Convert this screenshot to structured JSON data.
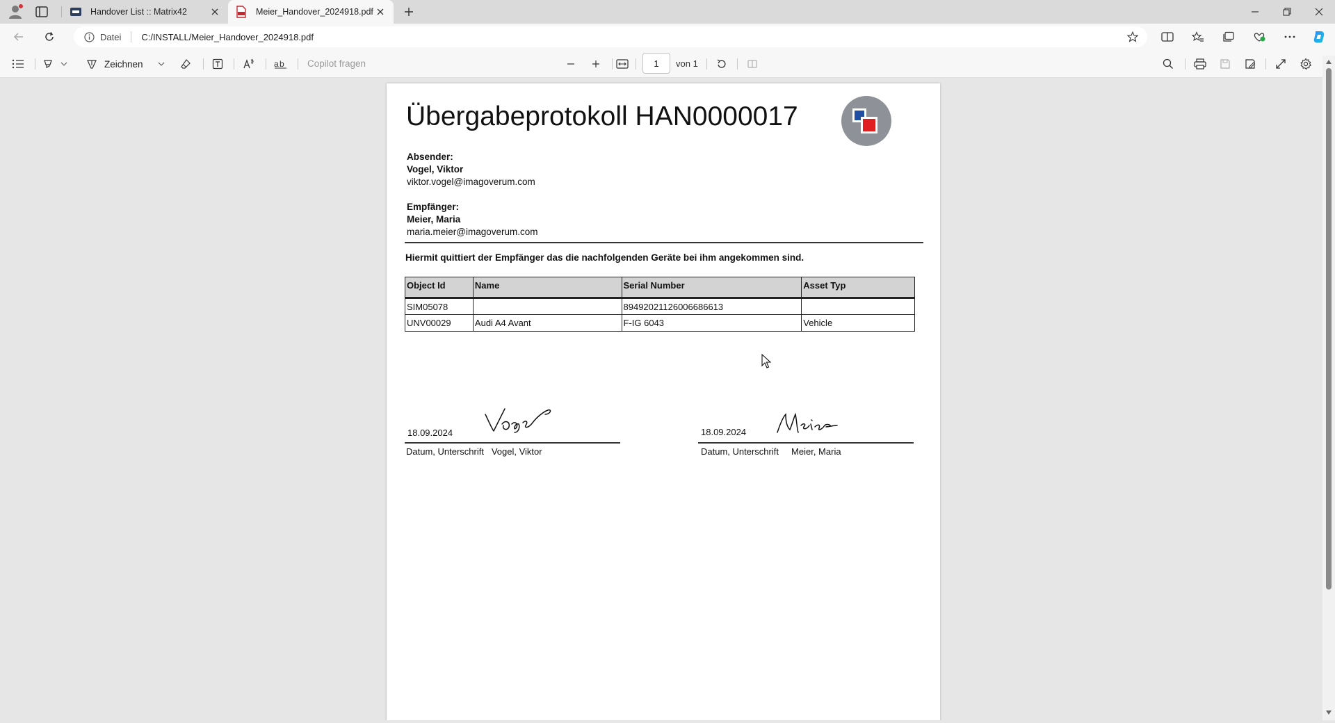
{
  "browser": {
    "tabs": [
      {
        "label": "Handover List :: Matrix42",
        "active": false,
        "icon": "matrix42-favicon"
      },
      {
        "label": "Meier_Handover_2024918.pdf",
        "active": true,
        "icon": "pdf-icon"
      }
    ],
    "address": {
      "scheme_label": "Datei",
      "url": "C:/INSTALL/Meier_Handover_2024918.pdf"
    }
  },
  "pdf_toolbar": {
    "draw_label": "Zeichnen",
    "copilot_placeholder": "Copilot fragen",
    "page_current": "1",
    "page_total_label": "von 1"
  },
  "document": {
    "title": "Übergabeprotokoll HAN0000017",
    "sender": {
      "label": "Absender:",
      "name": "Vogel, Viktor",
      "email": "viktor.vogel@imagoverum.com"
    },
    "recipient": {
      "label": "Empfänger:",
      "name": "Meier, Maria",
      "email": "maria.meier@imagoverum.com"
    },
    "statement": "Hiermit quittiert der Empfänger das die nachfolgenden Geräte bei ihm angekommen sind.",
    "table": {
      "headers": [
        "Object Id",
        "Name",
        "Serial Number",
        "Asset Typ"
      ],
      "rows": [
        [
          "SIM05078",
          "",
          "89492021126006686613",
          ""
        ],
        [
          "UNV00029",
          "Audi A4 Avant",
          "F-IG 6043",
          "Vehicle"
        ]
      ]
    },
    "signatures": [
      {
        "date": "18.09.2024",
        "caption": "Datum, Unterschrift",
        "name": "Vogel, Viktor",
        "signature_text": "Vogel"
      },
      {
        "date": "18.09.2024",
        "caption": "Datum, Unterschrift",
        "name": "Meier, Maria",
        "signature_text": "Meier"
      }
    ]
  },
  "colors": {
    "accent_blue": "#1f4ea3",
    "accent_red": "#e02020",
    "logo_grey": "#8e9198"
  }
}
